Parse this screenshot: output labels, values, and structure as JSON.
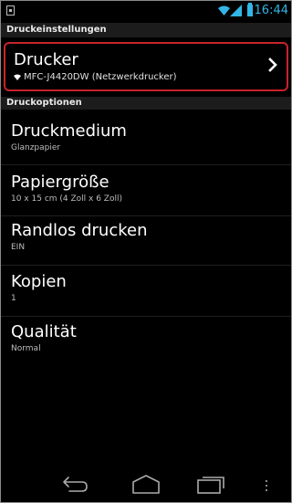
{
  "status_bar": {
    "time": "16:44",
    "icons": [
      "notification-icon",
      "wifi-icon",
      "signal-icon",
      "battery-icon"
    ],
    "accent": "#33b5e5"
  },
  "sections": {
    "print_settings_header": "Druckeinstellungen",
    "print_options_header": "Druckoptionen"
  },
  "printer": {
    "title": "Drucker",
    "value": "MFC-J4420DW (Netzwerkdrucker)",
    "highlight_color": "#c8232c"
  },
  "options": [
    {
      "title": "Druckmedium",
      "value": "Glanzpapier"
    },
    {
      "title": "Papiergröße",
      "value": "10 x 15 cm (4 Zoll x 6 Zoll)"
    },
    {
      "title": "Randlos drucken",
      "value": "EIN"
    },
    {
      "title": "Kopien",
      "value": "1"
    },
    {
      "title": "Qualität",
      "value": "Normal"
    }
  ],
  "nav_bar": {
    "icons": [
      "back-icon",
      "home-icon",
      "recent-apps-icon",
      "overflow-menu-icon"
    ]
  }
}
